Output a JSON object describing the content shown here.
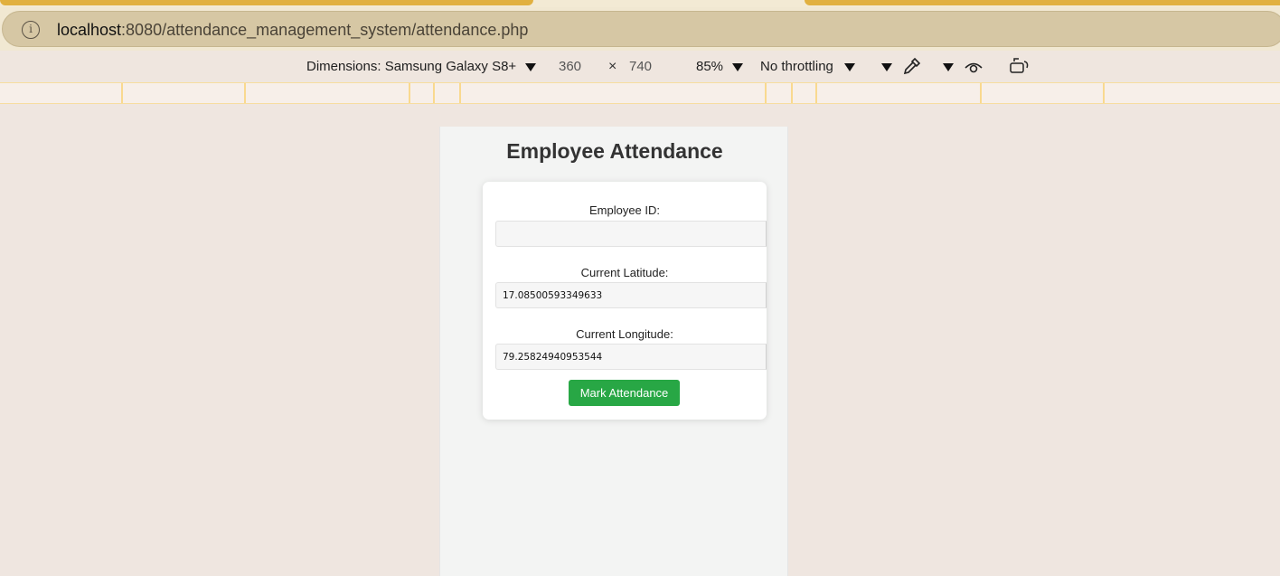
{
  "browser": {
    "url_host": "localhost",
    "url_rest": ":8080/attendance_management_system/attendance.php"
  },
  "device_toolbar": {
    "dimensions_label": "Dimensions: Samsung Galaxy S8+",
    "width": "360",
    "times": "×",
    "height": "740",
    "zoom": "85%",
    "throttling": "No throttling"
  },
  "page": {
    "title": "Employee Attendance",
    "employee_id_label": "Employee ID:",
    "employee_id_value": "",
    "latitude_label": "Current Latitude:",
    "latitude_value": "17.08500593349633",
    "longitude_label": "Current Longitude:",
    "longitude_value": "79.25824940953544",
    "submit_label": "Mark Attendance"
  },
  "colors": {
    "button": "#28a745",
    "tab_accent": "#e1b03f"
  },
  "icons": [
    "info-icon",
    "chevron-down-icon",
    "eyedropper-icon",
    "eye-icon",
    "rotate-icon"
  ]
}
